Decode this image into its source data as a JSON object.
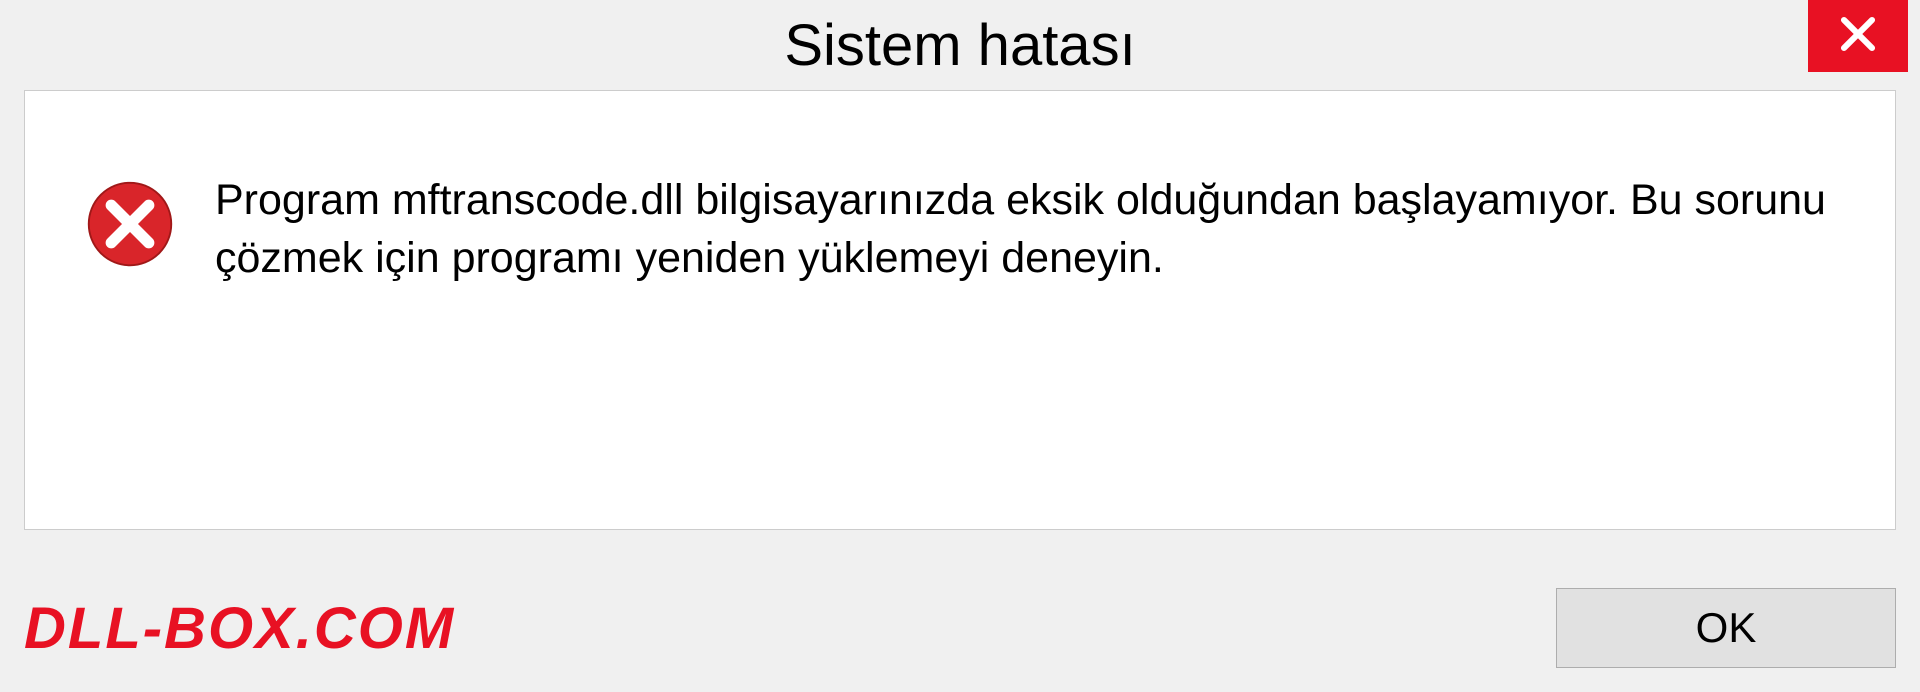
{
  "dialog": {
    "title": "Sistem hatası",
    "message": "Program mftranscode.dll bilgisayarınızda eksik olduğundan başlayamıyor. Bu sorunu çözmek için programı yeniden yüklemeyi deneyin.",
    "ok_label": "OK"
  },
  "watermark": "DLL-BOX.COM",
  "colors": {
    "accent_red": "#e81123",
    "background": "#f0f0f0",
    "content_bg": "#ffffff"
  }
}
